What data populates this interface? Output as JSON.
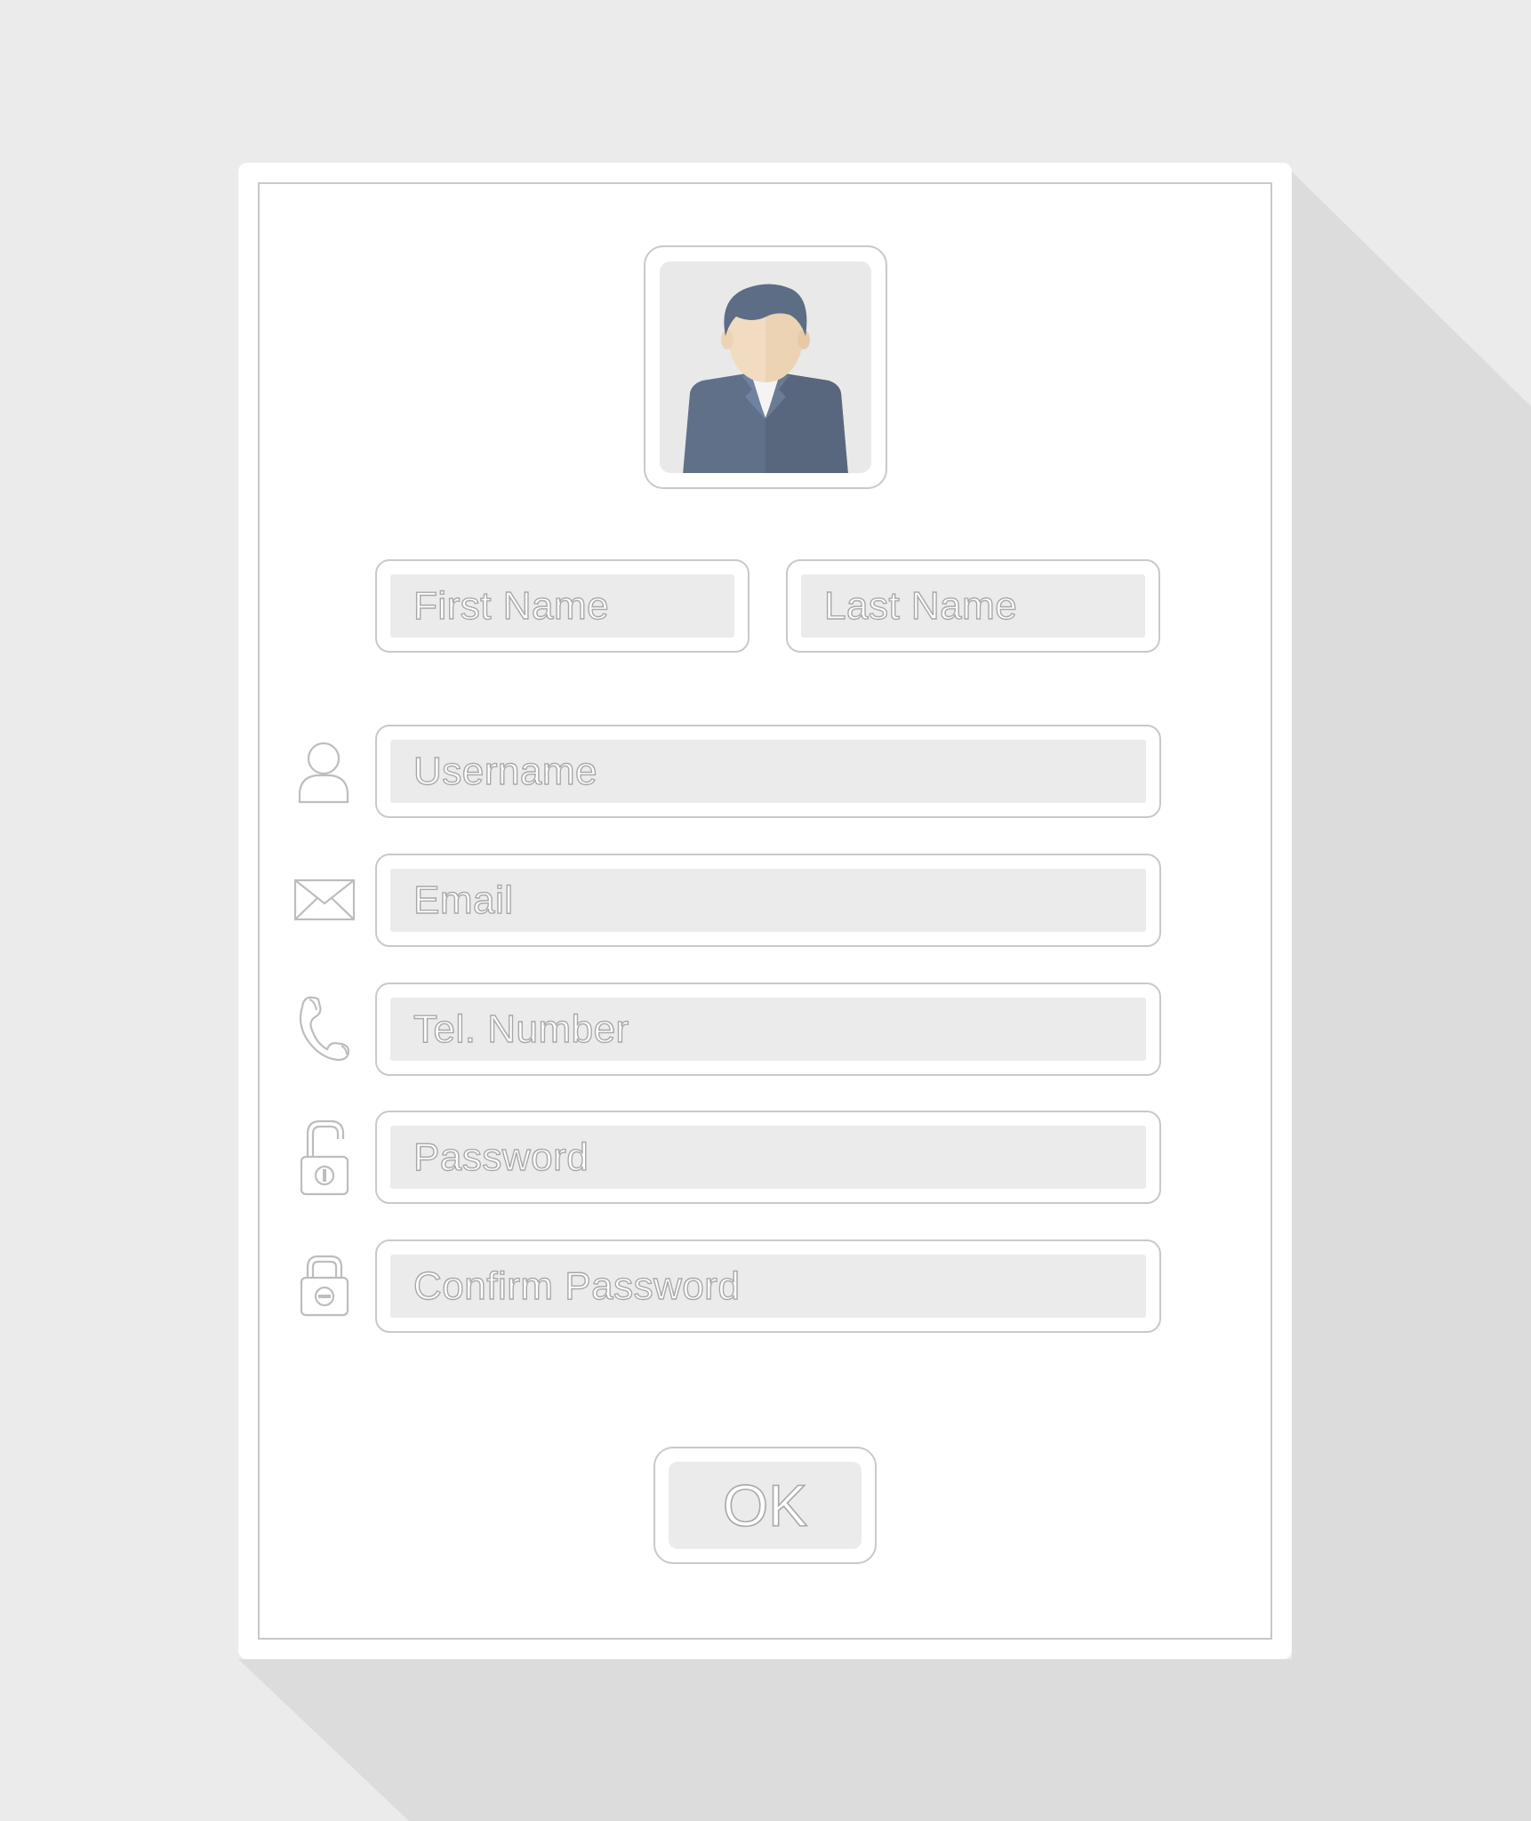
{
  "form": {
    "fields": {
      "first_name": {
        "placeholder": "First Name"
      },
      "last_name": {
        "placeholder": "Last Name"
      },
      "username": {
        "placeholder": "Username",
        "icon": "user-icon"
      },
      "email": {
        "placeholder": "Email",
        "icon": "envelope-icon"
      },
      "phone": {
        "placeholder": "Tel. Number",
        "icon": "phone-icon"
      },
      "password": {
        "placeholder": "Password",
        "icon": "unlocked-padlock-icon"
      },
      "confirm_password": {
        "placeholder": "Confirm Password",
        "icon": "locked-padlock-icon"
      }
    },
    "submit_label": "OK"
  },
  "colors": {
    "background": "#ebebeb",
    "card": "#ffffff",
    "border": "#c9c9c9",
    "field_fill": "#ebebeb",
    "placeholder_outline": "#a8a8a8",
    "suit": "#5f7088",
    "hair": "#5d6d85",
    "skin": "#f1dcc2"
  }
}
